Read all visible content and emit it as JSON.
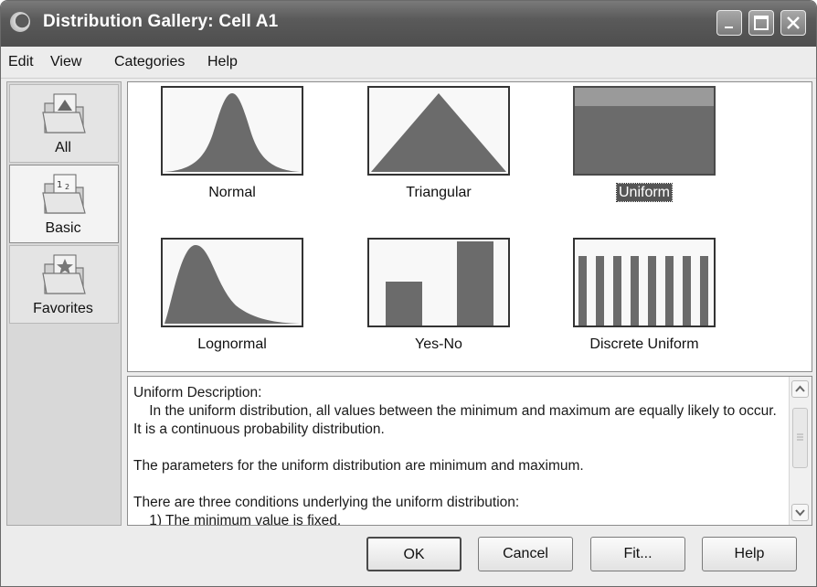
{
  "window": {
    "title": "Distribution Gallery: Cell A1"
  },
  "menu": [
    "Edit",
    "View",
    "Categories",
    "Help"
  ],
  "sidebar": {
    "tabs": [
      {
        "label": "All",
        "icon": "folder-all-icon"
      },
      {
        "label": "Basic",
        "icon": "folder-basic-icon"
      },
      {
        "label": "Favorites",
        "icon": "folder-favorites-icon"
      }
    ],
    "selected": "Basic"
  },
  "gallery": {
    "items": [
      {
        "label": "Normal",
        "icon": "normal-curve-icon"
      },
      {
        "label": "Triangular",
        "icon": "triangle-icon"
      },
      {
        "label": "Uniform",
        "icon": "uniform-block-icon"
      },
      {
        "label": "Lognormal",
        "icon": "lognormal-curve-icon"
      },
      {
        "label": "Yes-No",
        "icon": "yes-no-bars-icon"
      },
      {
        "label": "Discrete Uniform",
        "icon": "discrete-bars-icon"
      }
    ],
    "selected": "Uniform"
  },
  "description": {
    "heading": "Uniform Description:",
    "body": "    In the uniform distribution, all values between the minimum and maximum are equally likely to occur. It is a continuous probability distribution.\n\nThe parameters for the uniform distribution are minimum and maximum.\n\nThere are three conditions underlying the uniform distribution:\n    1) The minimum value is fixed."
  },
  "buttons": {
    "ok": "OK",
    "cancel": "Cancel",
    "fit": "Fit...",
    "help": "Help"
  },
  "colors": {
    "title_bar": "#555555",
    "plot_fill": "#6b6b6b",
    "selection": "#555555"
  }
}
